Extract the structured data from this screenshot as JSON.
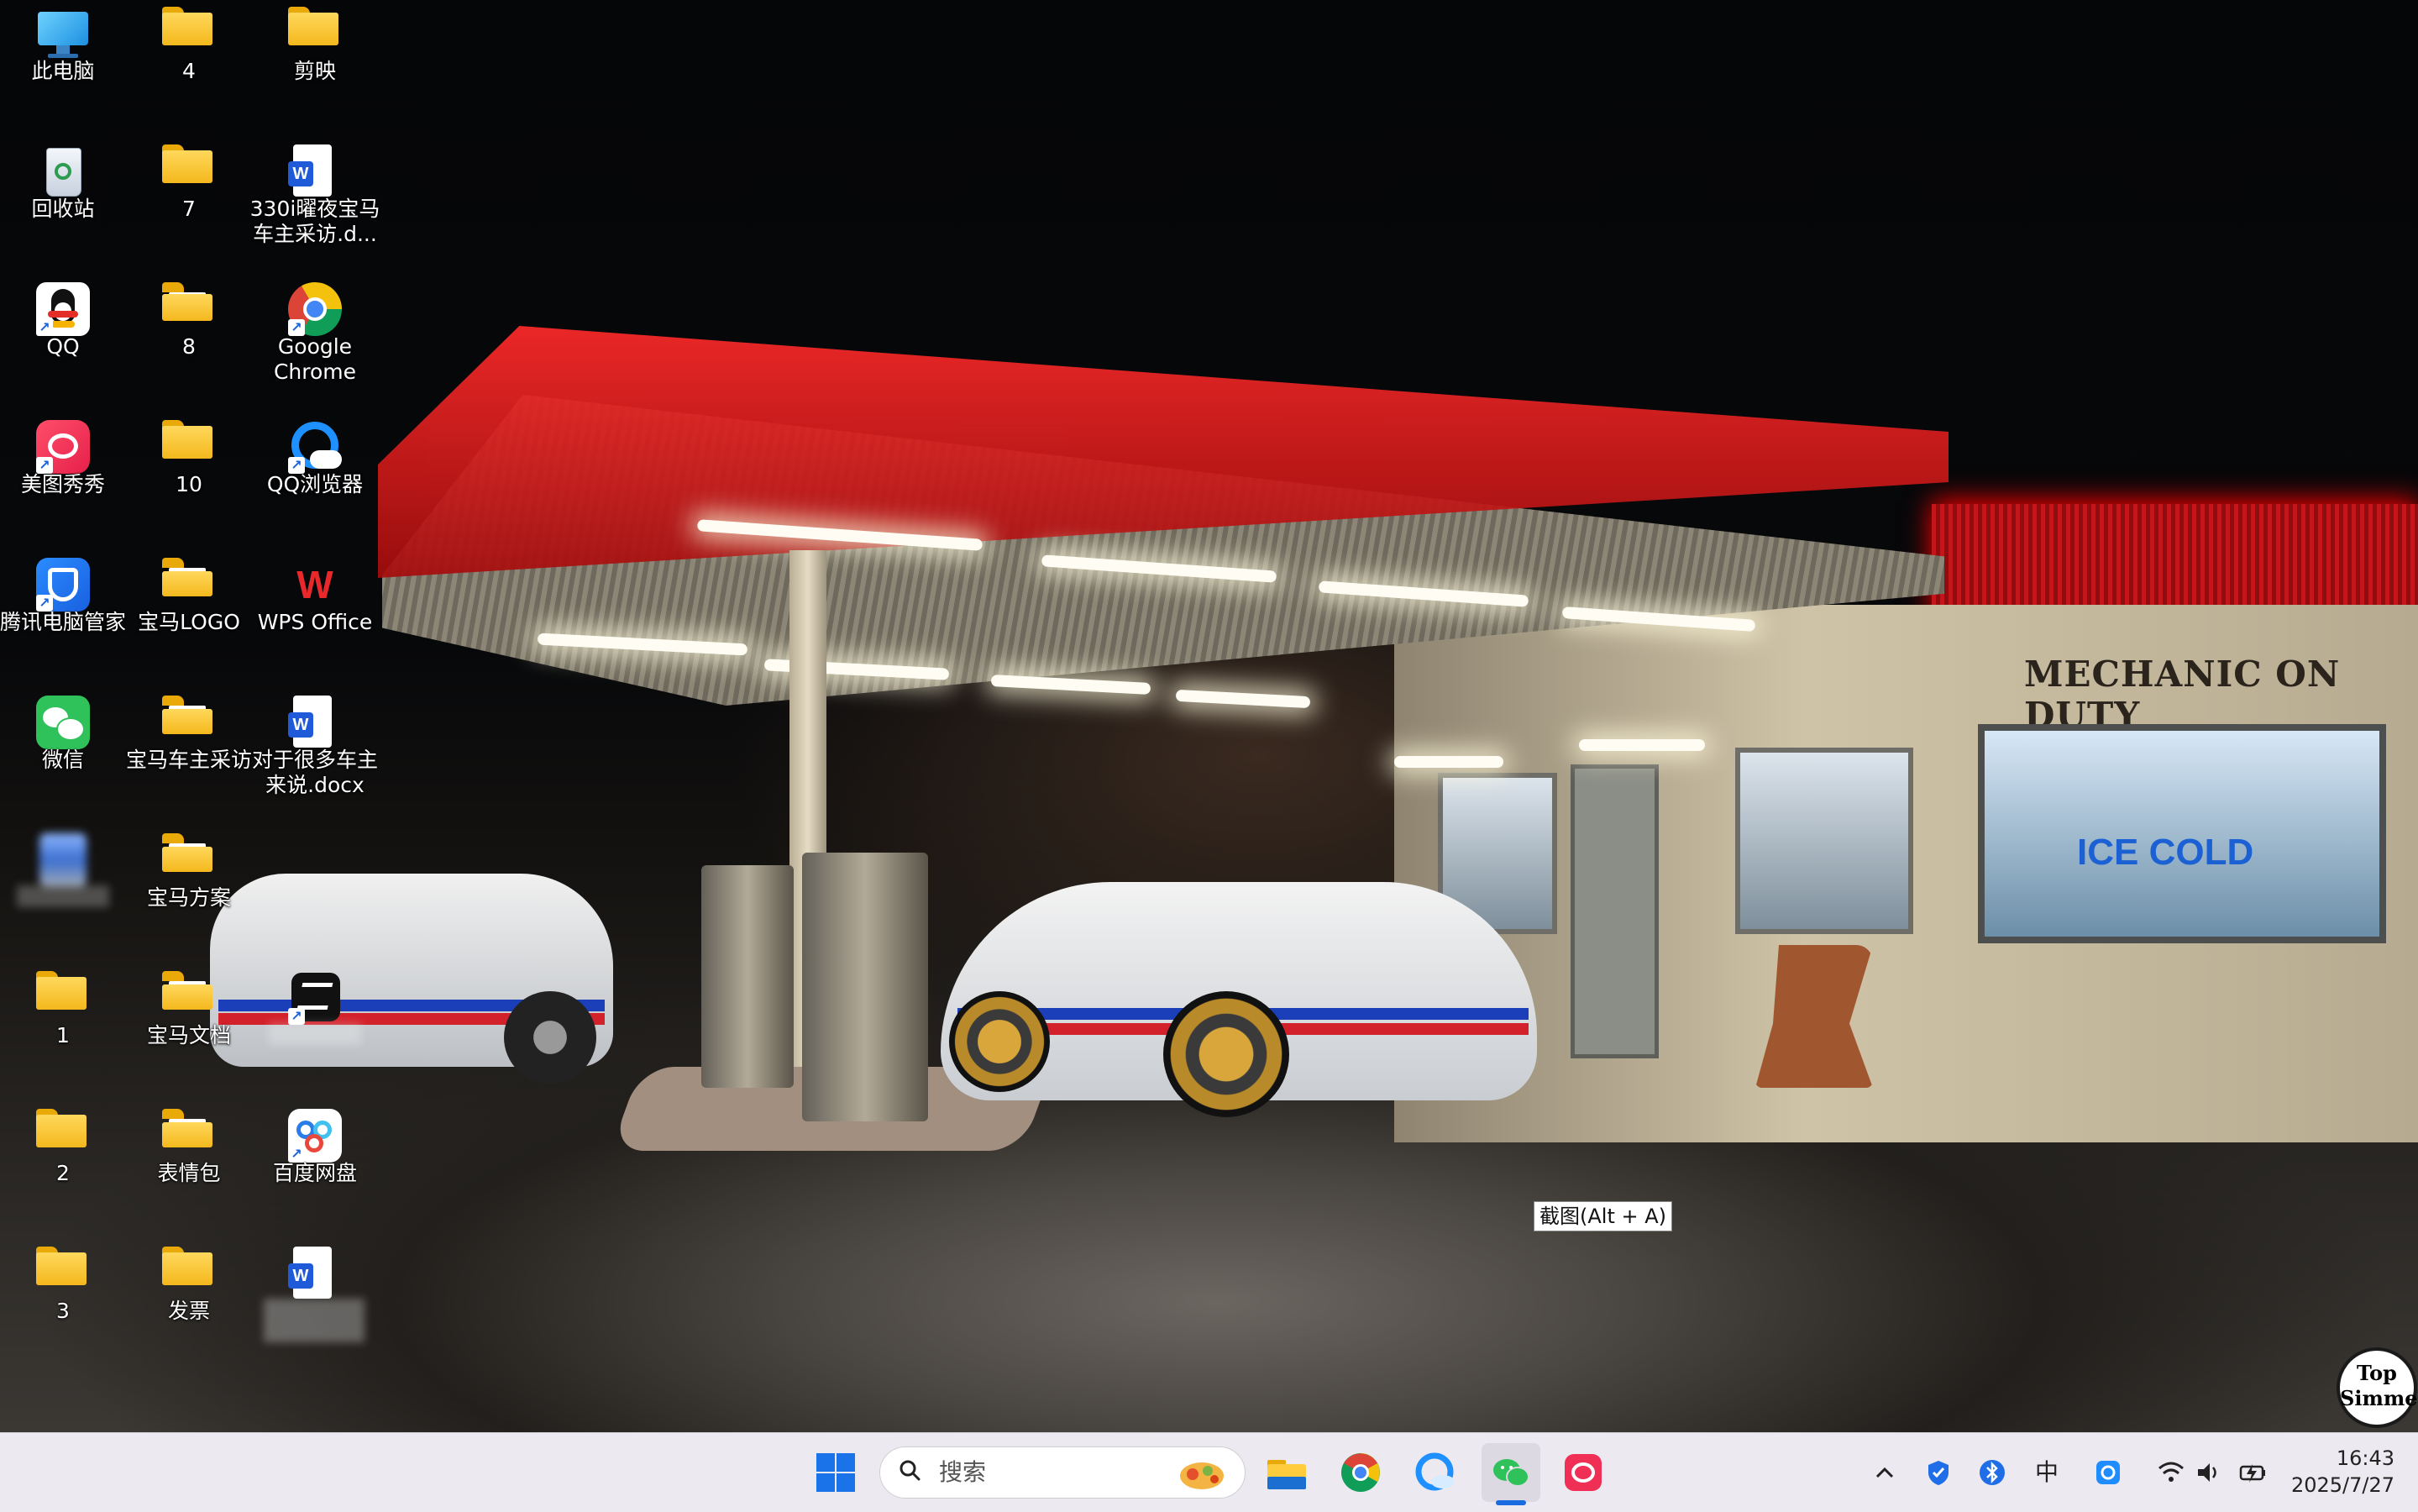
{
  "desktop": {
    "icons": [
      {
        "label": "此电脑"
      },
      {
        "label": "回收站"
      },
      {
        "label": "QQ"
      },
      {
        "label": "美图秀秀"
      },
      {
        "label": "腾讯电脑管家"
      },
      {
        "label": "微信"
      },
      {
        "label": ""
      },
      {
        "label": "1"
      },
      {
        "label": "2"
      },
      {
        "label": "3"
      },
      {
        "label": "4"
      },
      {
        "label": "7"
      },
      {
        "label": "8"
      },
      {
        "label": "10"
      },
      {
        "label": "宝马LOGO"
      },
      {
        "label": "宝马车主采访"
      },
      {
        "label": "宝马方案"
      },
      {
        "label": "宝马文档"
      },
      {
        "label": "表情包"
      },
      {
        "label": "发票"
      },
      {
        "label": "剪映"
      },
      {
        "label": "330i曜夜宝马车主采访.d..."
      },
      {
        "label": "Google Chrome"
      },
      {
        "label": "QQ浏览器"
      },
      {
        "label": "WPS Office"
      },
      {
        "label": "对于很多车主来说.docx"
      },
      {
        "label": ""
      },
      {
        "label": "百度网盘"
      },
      {
        "label": ""
      }
    ],
    "wallpaper_sign": "MECHANIC ON DUTY",
    "wallpaper_window_text": "ICE COLD",
    "watermark": "Top Simmer",
    "tooltip": "截图(Alt + A)"
  },
  "taskbar": {
    "search_placeholder": "搜索",
    "ime_indicator": "中",
    "time": "16:43",
    "date": "2025/7/27"
  }
}
